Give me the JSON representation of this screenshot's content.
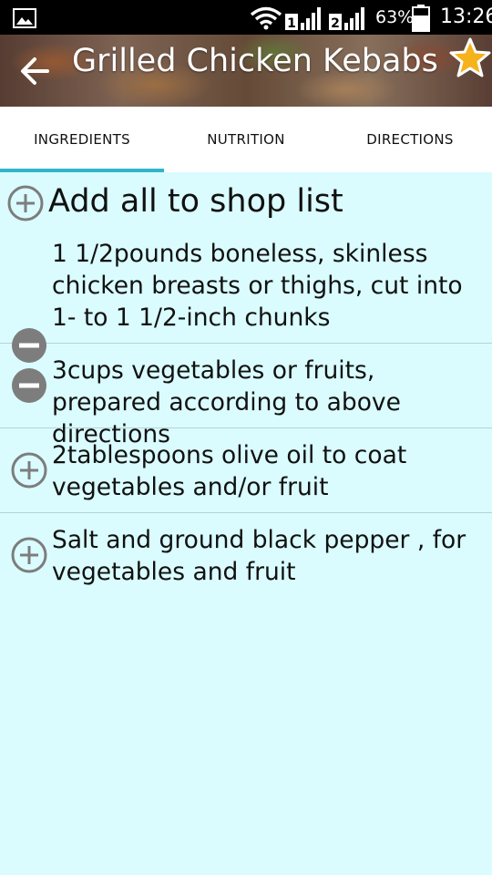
{
  "status_bar": {
    "left_icon": "gallery-icon",
    "battery_percent": "63%",
    "time": "13:26",
    "sim1_label": "1",
    "sim2_label": "2"
  },
  "header": {
    "title": "Grilled Chicken Kebabs",
    "back_icon": "arrow-back-icon",
    "favorite_icon": "star-icon"
  },
  "tabs": [
    {
      "label": "INGREDIENTS",
      "selected": true
    },
    {
      "label": "NUTRITION",
      "selected": false
    },
    {
      "label": "DIRECTIONS",
      "selected": false
    }
  ],
  "shop_list_action": {
    "label": "Add all to shop list",
    "icon": "plus-circle-icon"
  },
  "ingredients": [
    {
      "text": "1 1/2pounds boneless, skinless chicken breasts or thighs, cut into 1- to 1 1/2-inch chunks",
      "in_shop_list": true
    },
    {
      "text": "3cups vegetables or fruits, prepared according to above directions",
      "in_shop_list": true
    },
    {
      "text": "2tablespoons olive oil to coat vegetables and/or fruit",
      "in_shop_list": false
    },
    {
      "text": "Salt and ground black pepper , for vegetables and fruit",
      "in_shop_list": false
    }
  ],
  "colors": {
    "background": "#dafcfe",
    "accent": "#31b5c9",
    "icon_grey": "#7d7d7d",
    "star": "#f5b21b"
  }
}
